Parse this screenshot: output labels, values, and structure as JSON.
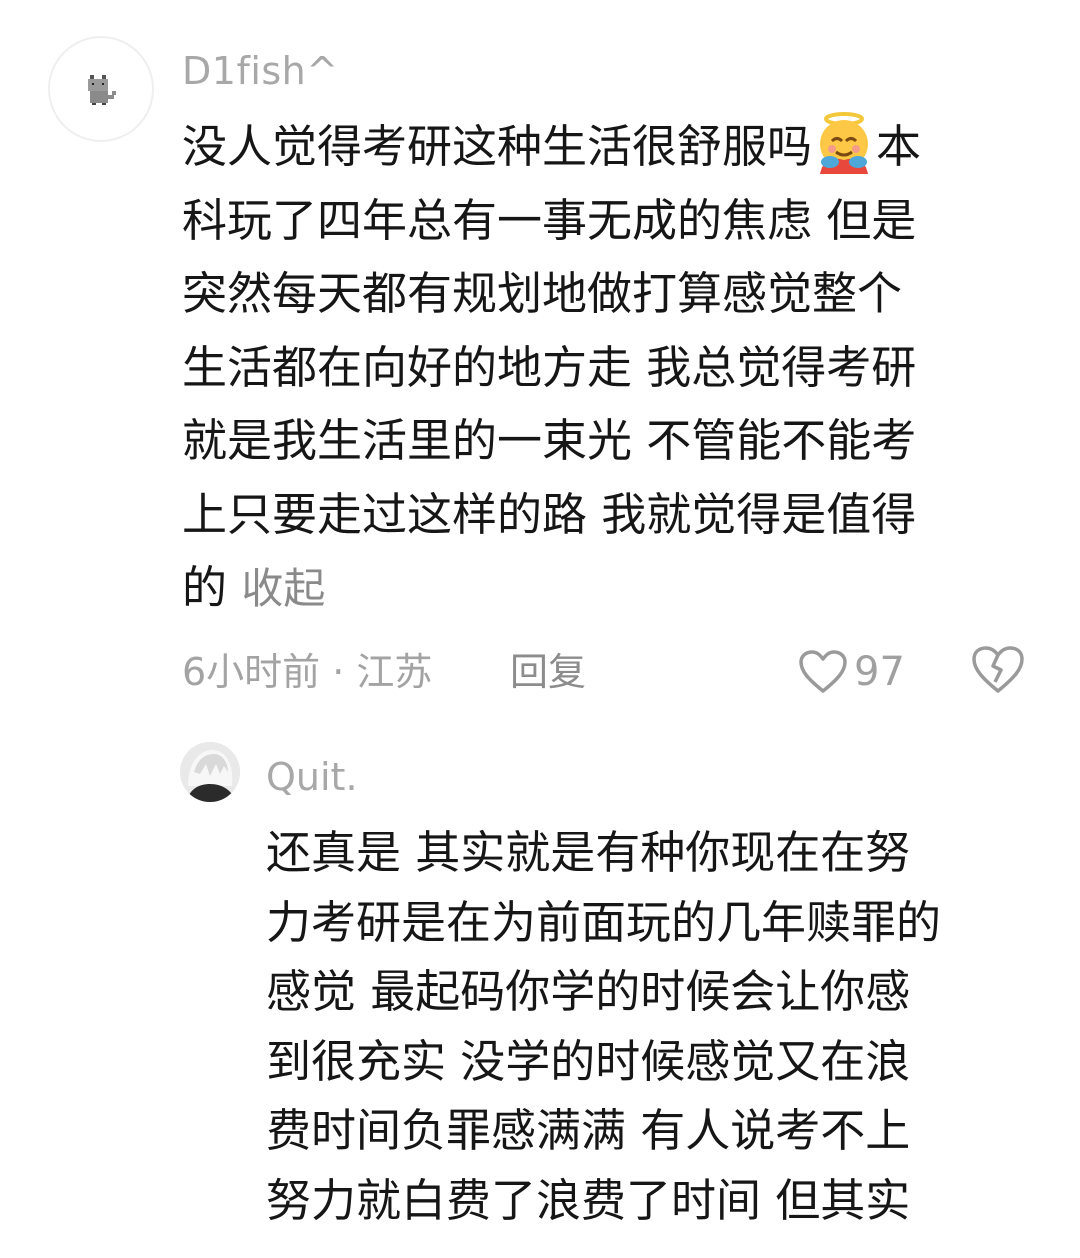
{
  "comment": {
    "username": "D1fish^",
    "avatar_icon": "pixel-cat-icon",
    "lines": [
      "没人觉得考研这种生活很舒服吗",
      "科玩了四年总有一事无成的焦虑 但是",
      "突然每天都有规划地做打算感觉整个",
      "生活都在向好的地方走 我总觉得考研",
      "就是我生活里的一束光 不管能不能考",
      "上只要走过这样的路 我就觉得是值得",
      "的"
    ],
    "line1_after_emoji": "本",
    "emoji": "smiling-face-with-halo-hugging-emoji",
    "collapse_label": "收起",
    "time_location": "6小时前 · 江苏",
    "reply_label": "回复",
    "like_count": "97",
    "like_icon": "heart-outline-icon",
    "dislike_icon": "broken-heart-icon"
  },
  "reply": {
    "username": "Quit.",
    "avatar_icon": "anime-avatar-icon",
    "lines": [
      "还真是 其实就是有种你现在在努",
      "力考研是在为前面玩的几年赎罪的",
      "感觉 最起码你学的时候会让你感",
      "到很充实 没学的时候感觉又在浪",
      "费时间负罪感满满 有人说考不上",
      "努力就白费了浪费了时间 但其实"
    ]
  },
  "colors": {
    "text": "#161616",
    "muted": "#a8a8a8",
    "background": "#ffffff"
  }
}
